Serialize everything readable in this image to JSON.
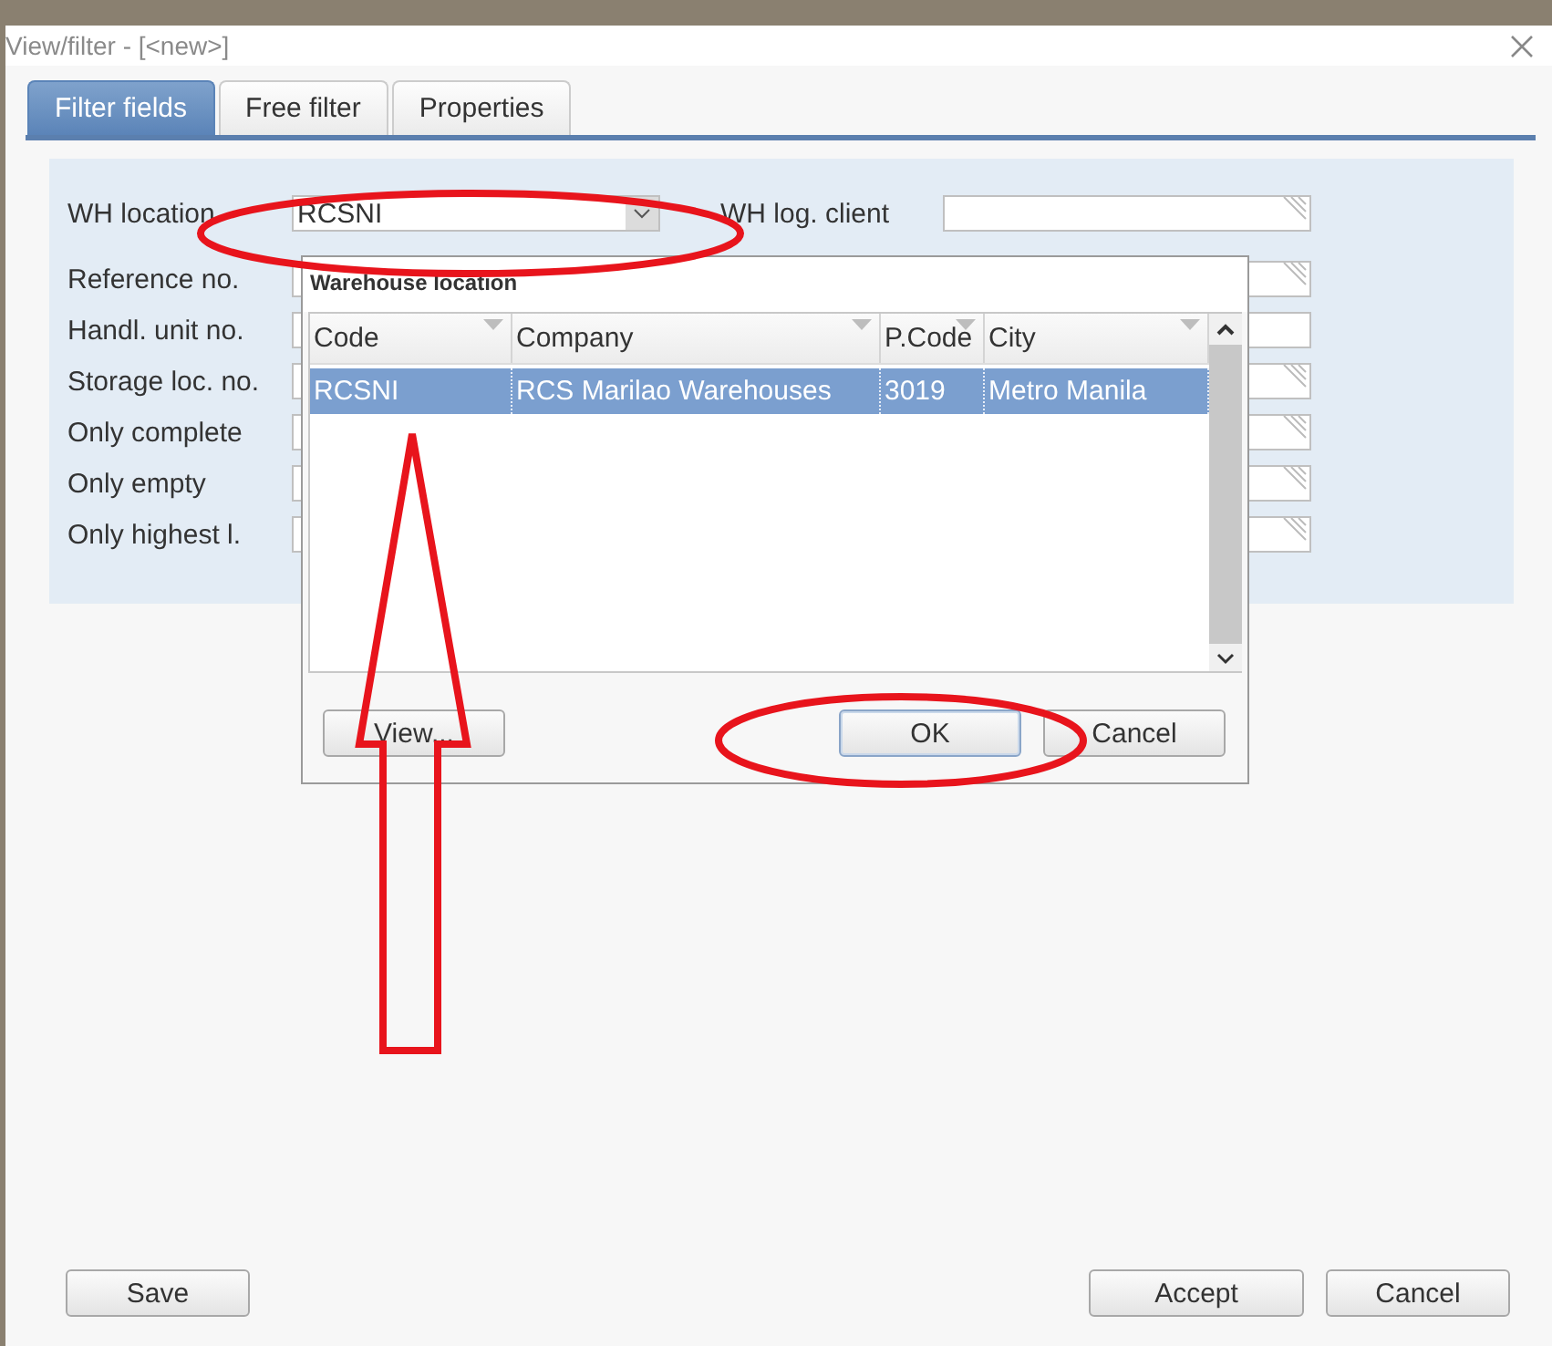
{
  "window": {
    "title": "View/filter - [<new>]"
  },
  "tabs": [
    {
      "label": "Filter fields",
      "selected": true
    },
    {
      "label": "Free filter",
      "selected": false
    },
    {
      "label": "Properties",
      "selected": false
    }
  ],
  "filter_rows": [
    {
      "label": "WH location",
      "kind": "combo",
      "value": "RCSNI",
      "right_label": "WH log. client",
      "right_lookup": true
    },
    {
      "label": "Reference no.",
      "kind": "text",
      "right_lookup": true
    },
    {
      "label": "Handl. unit no.",
      "kind": "text",
      "right_lookup": false
    },
    {
      "label": "Storage loc. no.",
      "kind": "text",
      "right_lookup": true
    },
    {
      "label": "Only complete",
      "kind": "text",
      "right_lookup": true
    },
    {
      "label": "Only empty",
      "kind": "text",
      "right_lookup": true
    },
    {
      "label": "Only highest l.",
      "kind": "text",
      "right_lookup": true
    }
  ],
  "lookup": {
    "title": "Warehouse location",
    "columns": [
      "Code",
      "Company",
      "P.Code",
      "City"
    ],
    "rows": [
      {
        "cells": [
          "RCSNI",
          "RCS Marilao Warehouses",
          "3019",
          "Metro Manila"
        ],
        "selected": true
      }
    ],
    "buttons": [
      {
        "label": "View...",
        "focused": false
      },
      {
        "label": "OK",
        "focused": true
      },
      {
        "label": "Cancel",
        "focused": false
      }
    ]
  },
  "footer": {
    "left_buttons": [
      "Save"
    ],
    "right_buttons": [
      "Accept",
      "Cancel"
    ]
  },
  "annotations": [
    {
      "kind": "ellipse"
    },
    {
      "kind": "ellipse"
    },
    {
      "kind": "arrow"
    }
  ]
}
